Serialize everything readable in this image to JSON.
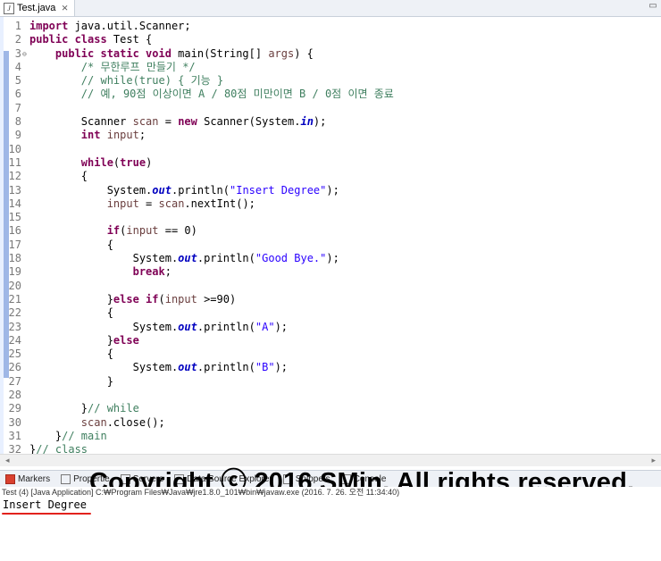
{
  "editor_tab": {
    "title": "Test.java",
    "icon": "java-file-icon",
    "close": "⨯"
  },
  "code_lines": [
    {
      "n": "1",
      "html": "<span class=\"kw\">import</span> java.util.Scanner;"
    },
    {
      "n": "2",
      "html": "<span class=\"kw\">public class</span> Test {"
    },
    {
      "n": "3",
      "fold": true,
      "html": "    <span class=\"kw\">public static void</span> main(String[] <span class=\"var\">args</span>) {"
    },
    {
      "n": "4",
      "html": "        <span class=\"cm\">/* 무한루프 만들기 */</span>"
    },
    {
      "n": "5",
      "html": "        <span class=\"cm\">// while(true) { 기능 }</span>"
    },
    {
      "n": "6",
      "html": "        <span class=\"cm\">// 예, 90점 이상이면 A / 80점 미만이면 B / 0점 이면 종료</span>"
    },
    {
      "n": "7",
      "html": ""
    },
    {
      "n": "8",
      "html": "        Scanner <span class=\"var\">scan</span> = <span class=\"kw\">new</span> Scanner(System.<span class=\"field\">in</span>);"
    },
    {
      "n": "9",
      "html": "        <span class=\"kw\">int</span> <span class=\"var\">input</span>;"
    },
    {
      "n": "10",
      "html": ""
    },
    {
      "n": "11",
      "html": "        <span class=\"kw\">while</span>(<span class=\"kw\">true</span>)"
    },
    {
      "n": "12",
      "html": "        {"
    },
    {
      "n": "13",
      "html": "            System.<span class=\"field\">out</span>.println(<span class=\"str\">\"Insert Degree\"</span>);"
    },
    {
      "n": "14",
      "html": "            <span class=\"var\">input</span> = <span class=\"var\">scan</span>.nextInt();"
    },
    {
      "n": "15",
      "html": ""
    },
    {
      "n": "16",
      "html": "            <span class=\"kw\">if</span>(<span class=\"var\">input</span> == 0)"
    },
    {
      "n": "17",
      "html": "            {"
    },
    {
      "n": "18",
      "html": "                System.<span class=\"field\">out</span>.println(<span class=\"str\">\"Good Bye.\"</span>);"
    },
    {
      "n": "19",
      "html": "                <span class=\"kw\">break</span>;"
    },
    {
      "n": "20",
      "html": ""
    },
    {
      "n": "21",
      "html": "            }<span class=\"kw\">else if</span>(<span class=\"var\">input</span> >=90)"
    },
    {
      "n": "22",
      "html": "            {"
    },
    {
      "n": "23",
      "html": "                System.<span class=\"field\">out</span>.println(<span class=\"str\">\"A\"</span>);"
    },
    {
      "n": "24",
      "html": "            }<span class=\"kw\">else</span>"
    },
    {
      "n": "25",
      "html": "            {"
    },
    {
      "n": "26",
      "html": "                System.<span class=\"field\">out</span>.println(<span class=\"str\">\"B\"</span>);"
    },
    {
      "n": "27",
      "html": "            }"
    },
    {
      "n": "28",
      "html": ""
    },
    {
      "n": "29",
      "html": "        }<span class=\"cm\">// while</span>"
    },
    {
      "n": "30",
      "html": "        <span class=\"var\">scan</span>.close();"
    },
    {
      "n": "31",
      "html": "    }<span class=\"cm\">// main</span>"
    },
    {
      "n": "32",
      "html": "}<span class=\"cm\">// class</span>"
    }
  ],
  "view_tabs": [
    {
      "label": "Markers",
      "icon": "markers-icon"
    },
    {
      "label": "Propertie",
      "icon": "properties-icon"
    },
    {
      "label": "Servers",
      "icon": "servers-icon"
    },
    {
      "label": "Data Source Explorer",
      "icon": "data-source-icon"
    },
    {
      "label": "Snippets",
      "icon": "snippets-icon"
    },
    {
      "label": "Console",
      "icon": "console-icon"
    }
  ],
  "watermark": "Copyright ⓒ 2016 SMin. All rights reserved.",
  "console": {
    "header": "Test (4) [Java Application] C:₩Program Files₩Java₩jre1.8.0_101₩bin₩javaw.exe (2016. 7. 26. 오전 11:34:40)",
    "output": "Insert Degree"
  },
  "colors": {
    "keyword": "#7f0055",
    "comment": "#3f7f5f",
    "string": "#2a00ff",
    "field": "#0000c0",
    "underline": "#e2221c"
  }
}
